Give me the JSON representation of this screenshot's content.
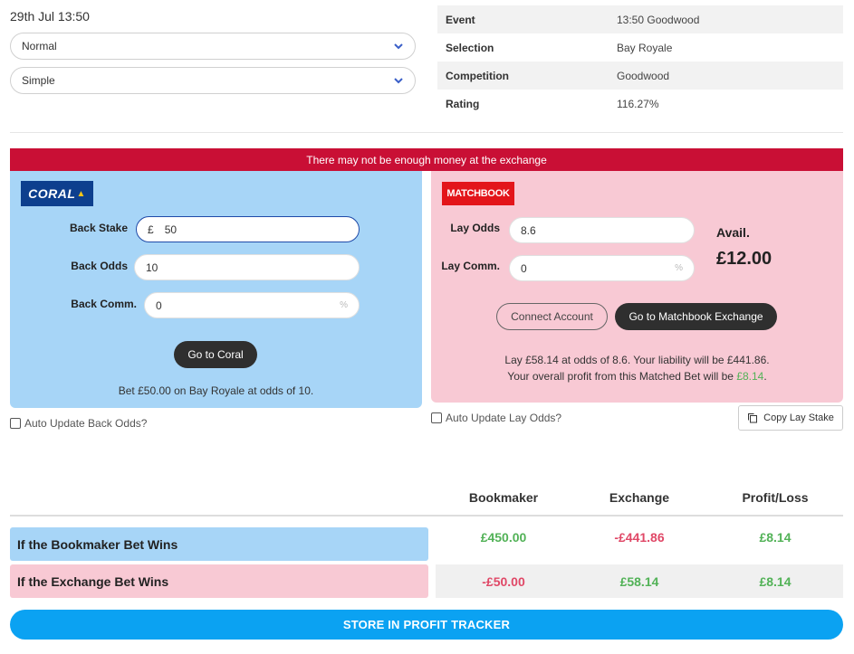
{
  "header": {
    "date": "29th Jul 13:50"
  },
  "selects": {
    "mode": "Normal",
    "type": "Simple"
  },
  "info": [
    {
      "key": "Event",
      "value": "13:50 Goodwood"
    },
    {
      "key": "Selection",
      "value": "Bay Royale"
    },
    {
      "key": "Competition",
      "value": "Goodwood"
    },
    {
      "key": "Rating",
      "value": "116.27%"
    }
  ],
  "warning": "There may not be enough money at the exchange",
  "back": {
    "logo": "CORAL",
    "stake_label": "Back Stake",
    "stake_currency": "£",
    "stake_value": "50",
    "odds_label": "Back Odds",
    "odds_value": "10",
    "comm_label": "Back Comm.",
    "comm_value": "0",
    "comm_unit": "%",
    "go_button": "Go to Coral",
    "note": "Bet £50.00 on Bay Royale at odds of 10.",
    "auto_update": "Auto Update Back Odds?"
  },
  "lay": {
    "logo": "MATCHBOOK",
    "odds_label": "Lay Odds",
    "odds_value": "8.6",
    "comm_label": "Lay Comm.",
    "comm_value": "0",
    "comm_unit": "%",
    "avail_label": "Avail.",
    "avail_value": "£12.00",
    "connect_button": "Connect Account",
    "go_button": "Go to Matchbook Exchange",
    "note_line1": "Lay £58.14 at odds of 8.6. Your liability will be £441.86.",
    "note_line2_prefix": "Your overall profit from this Matched Bet will be ",
    "note_line2_value": "£8.14",
    "note_line2_suffix": ".",
    "auto_update": "Auto Update Lay Odds?",
    "copy_button": "Copy Lay Stake"
  },
  "results": {
    "headers": [
      "Bookmaker",
      "Exchange",
      "Profit/Loss"
    ],
    "rows": [
      {
        "label": "If the Bookmaker Bet Wins",
        "bookmaker": "£450.00",
        "exchange": "-£441.86",
        "profit": "£8.14"
      },
      {
        "label": "If the Exchange Bet Wins",
        "bookmaker": "-£50.00",
        "exchange": "£58.14",
        "profit": "£8.14"
      }
    ]
  },
  "store_button": "STORE IN PROFIT TRACKER",
  "colors": {
    "back_panel": "#a7d5f7",
    "lay_panel": "#f8c9d4",
    "warning": "#c90f35",
    "store": "#0ba2f2",
    "positive": "#52b257",
    "negative": "#e04867"
  }
}
